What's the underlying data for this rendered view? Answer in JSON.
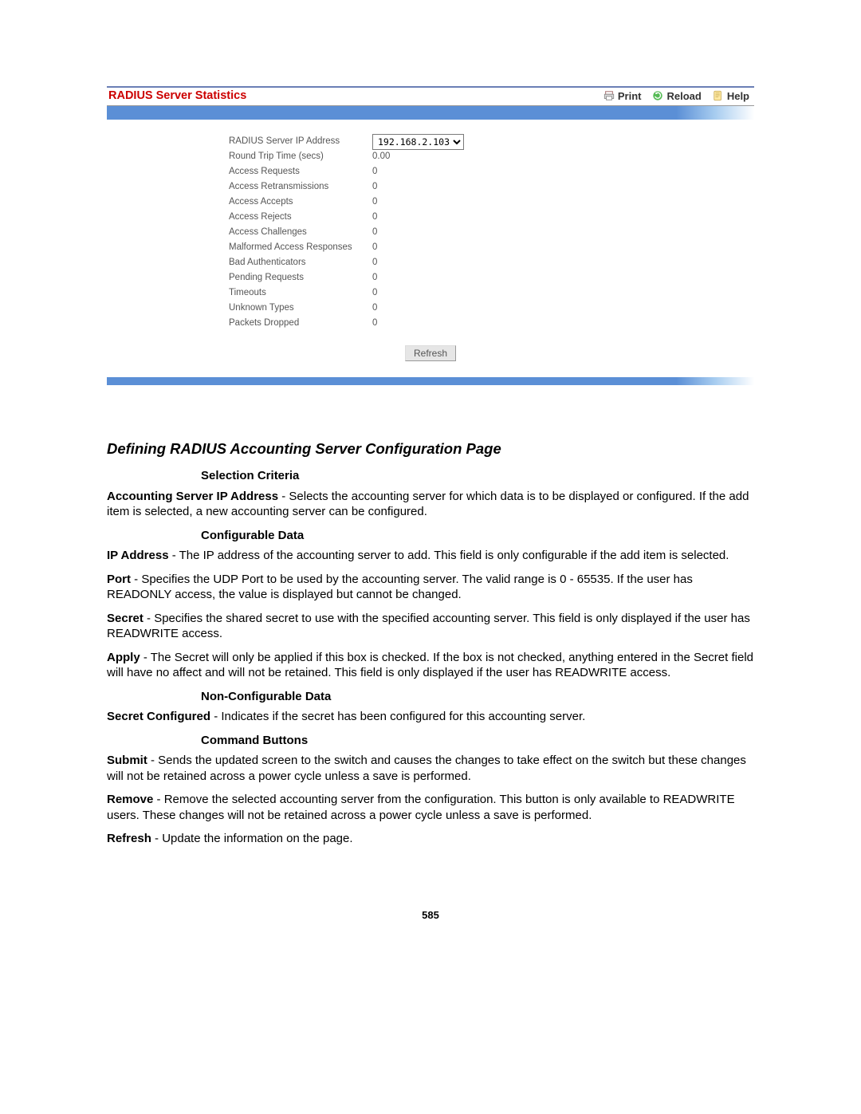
{
  "panel": {
    "title": "RADIUS Server Statistics",
    "actions": {
      "print": "Print",
      "reload": "Reload",
      "help": "Help"
    },
    "ip_select_value": "192.168.2.103",
    "refresh_label": "Refresh",
    "stats": [
      {
        "label": "RADIUS Server IP Address",
        "is_select": true
      },
      {
        "label": "Round Trip Time (secs)",
        "value": "0.00"
      },
      {
        "label": "Access Requests",
        "value": "0"
      },
      {
        "label": "Access Retransmissions",
        "value": "0"
      },
      {
        "label": "Access Accepts",
        "value": "0"
      },
      {
        "label": "Access Rejects",
        "value": "0"
      },
      {
        "label": "Access Challenges",
        "value": "0"
      },
      {
        "label": "Malformed Access Responses",
        "value": "0"
      },
      {
        "label": "Bad Authenticators",
        "value": "0"
      },
      {
        "label": "Pending Requests",
        "value": "0"
      },
      {
        "label": "Timeouts",
        "value": "0"
      },
      {
        "label": "Unknown Types",
        "value": "0"
      },
      {
        "label": "Packets Dropped",
        "value": "0"
      }
    ]
  },
  "doc": {
    "title": "Defining RADIUS Accounting Server Configuration Page",
    "sections": {
      "selection_criteria": {
        "heading": "Selection Criteria",
        "items": [
          {
            "term": "Accounting Server IP Address",
            "desc": " - Selects the accounting server for which data is to be displayed or configured. If the add item is selected, a new accounting server can be configured."
          }
        ]
      },
      "configurable_data": {
        "heading": "Configurable Data",
        "items": [
          {
            "term": "IP Address",
            "desc": " - The IP address of the accounting server to add. This field is only configurable if the add item is selected."
          },
          {
            "term": "Port",
            "desc": " - Specifies the UDP Port to be used by the accounting server. The valid range is 0 - 65535. If the user has READONLY access, the value is displayed but cannot be changed."
          },
          {
            "term": "Secret",
            "desc": " - Specifies the shared secret to use with the specified accounting server. This field is only displayed if the user has READWRITE access."
          },
          {
            "term": "Apply",
            "desc": " - The Secret will only be applied if this box is checked. If the box is not checked, anything entered in the Secret field will have no affect and will not be retained. This field is only displayed if the user has READWRITE access."
          }
        ]
      },
      "non_configurable_data": {
        "heading": "Non-Configurable Data",
        "items": [
          {
            "term": "Secret Configured",
            "desc": " - Indicates if the secret has been configured for this accounting server."
          }
        ]
      },
      "command_buttons": {
        "heading": "Command Buttons",
        "items": [
          {
            "term": "Submit",
            "desc": " - Sends the updated screen to the switch and causes the changes to take effect on the switch but these changes will not be retained across a power cycle unless a save is performed."
          },
          {
            "term": "Remove",
            "desc": " - Remove the selected accounting server from the configuration. This button is only available to READWRITE users. These changes will not be retained across a power cycle unless a save is performed."
          },
          {
            "term": "Refresh",
            "desc": " - Update the information on the page."
          }
        ]
      }
    }
  },
  "page_number": "585"
}
